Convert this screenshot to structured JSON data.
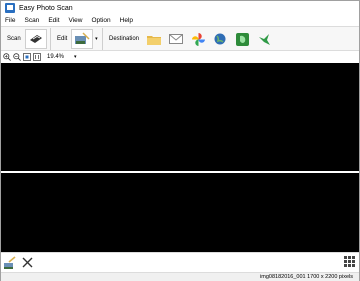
{
  "window": {
    "title": "Easy Photo Scan"
  },
  "menu": [
    "File",
    "Scan",
    "Edit",
    "View",
    "Option",
    "Help"
  ],
  "toolbar": {
    "scan_label": "Scan",
    "edit_label": "Edit",
    "destination_label": "Destination",
    "destinations": [
      "folder-icon",
      "mail-icon",
      "pinwheel-icon",
      "globe-icon",
      "evernote-icon",
      "bird-icon"
    ]
  },
  "zoom": {
    "value": "19.4%"
  },
  "status": {
    "text": "img08182016_001 1700 x 2200 pixels"
  },
  "colors": {
    "accent": "#2a6fc0",
    "preview_bg": "#000000"
  }
}
